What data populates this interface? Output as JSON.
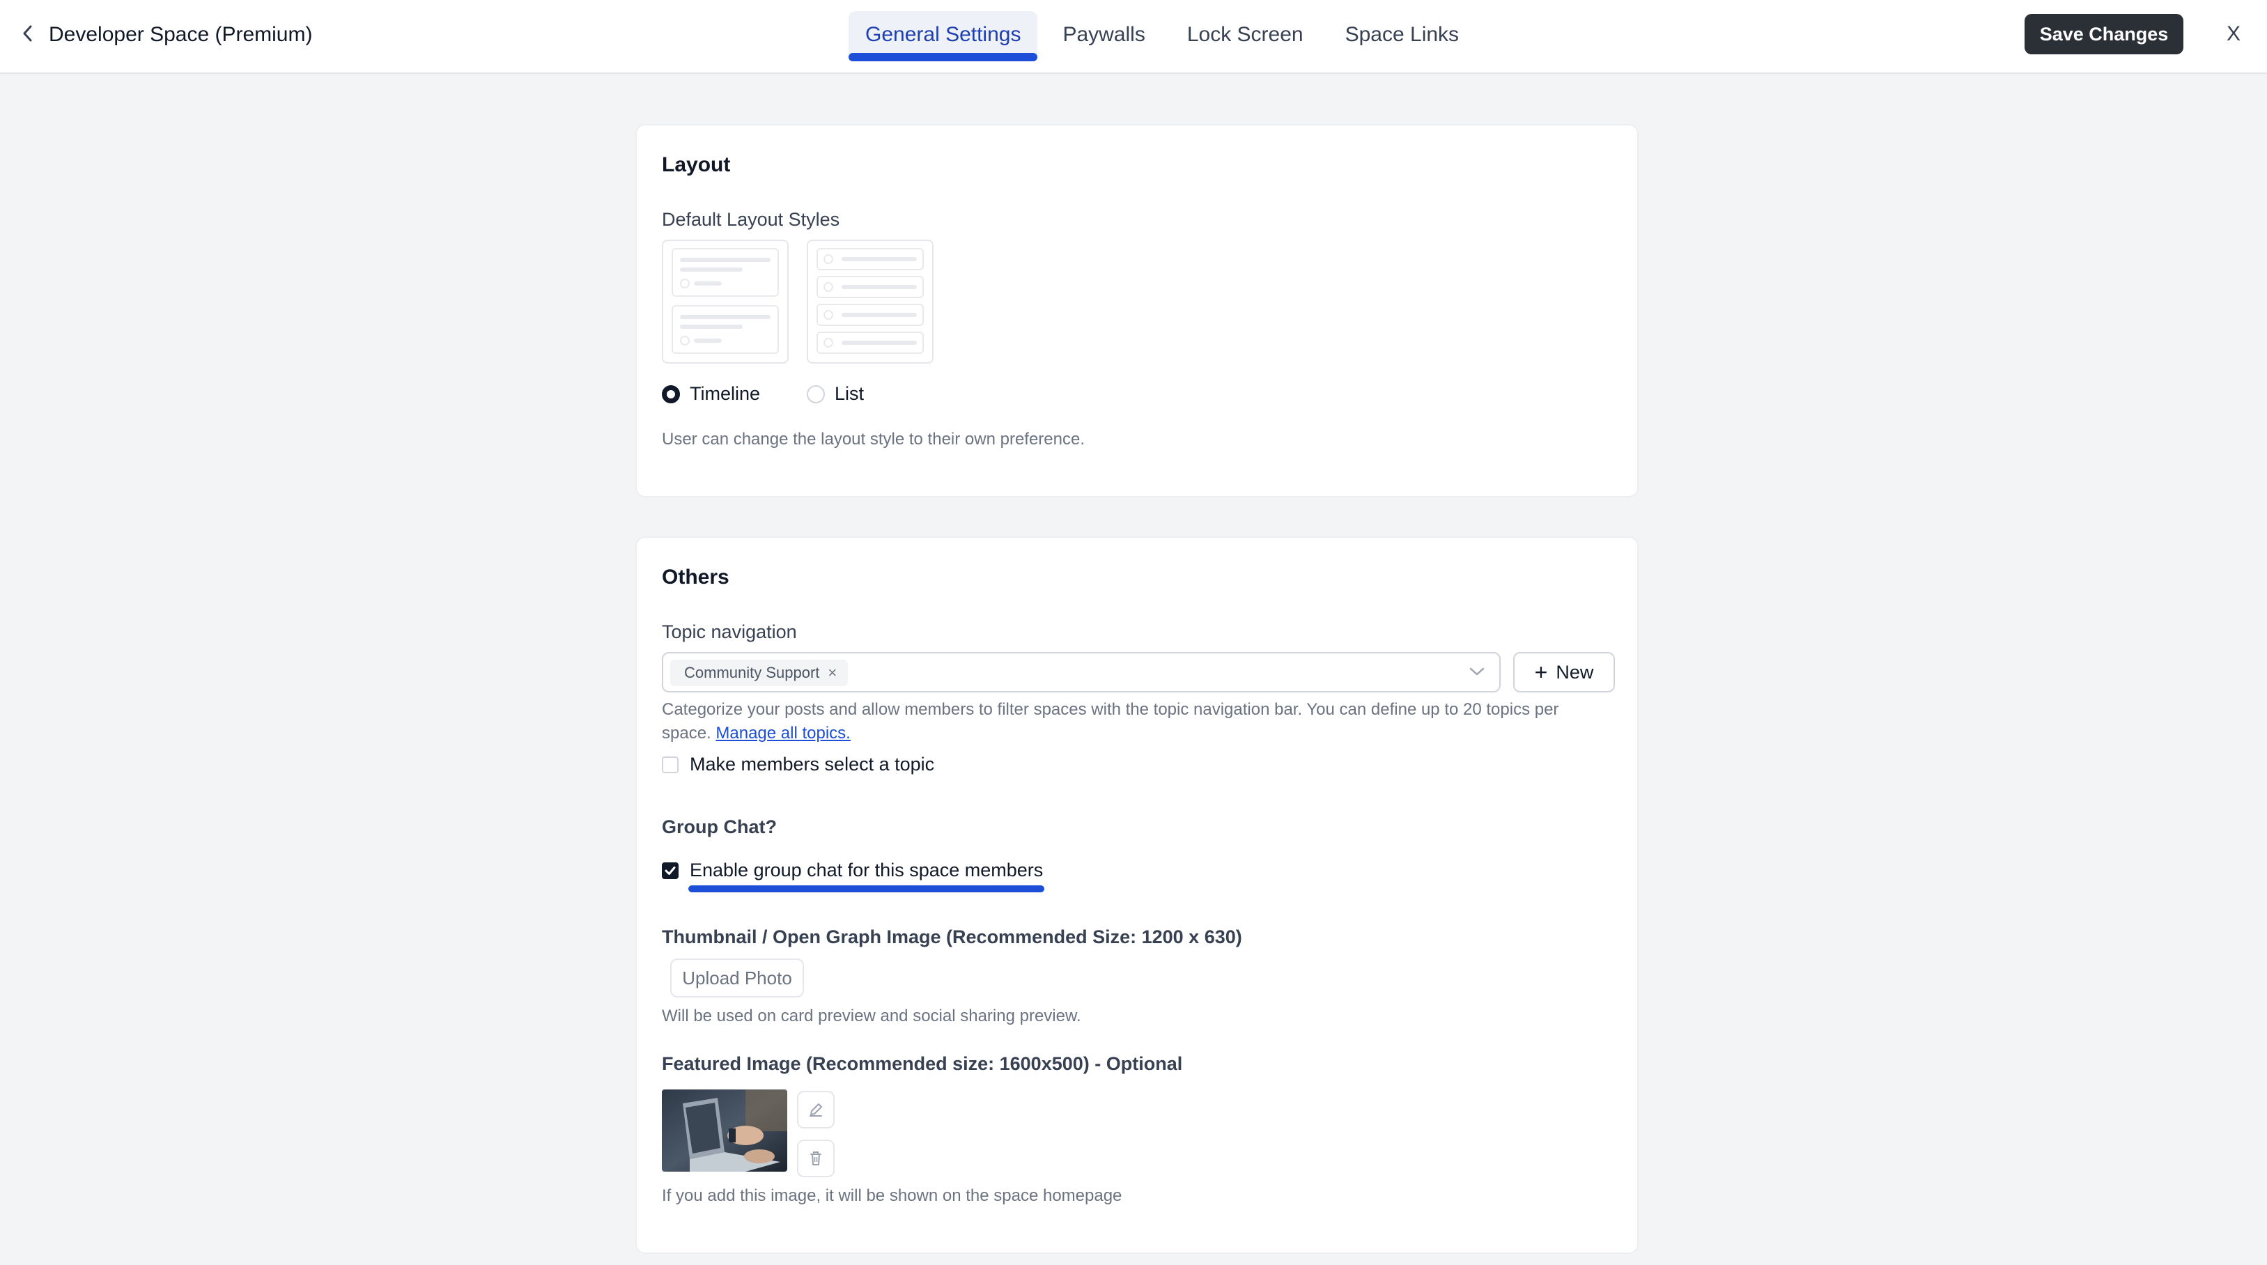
{
  "header": {
    "title": "Developer Space (Premium)",
    "tabs": [
      {
        "label": "General Settings",
        "active": true
      },
      {
        "label": "Paywalls",
        "active": false
      },
      {
        "label": "Lock Screen",
        "active": false
      },
      {
        "label": "Space Links",
        "active": false
      }
    ],
    "save_label": "Save Changes",
    "close_label": "X"
  },
  "layout_card": {
    "title": "Layout",
    "subtitle": "Default Layout Styles",
    "options": [
      {
        "label": "Timeline",
        "selected": true
      },
      {
        "label": "List",
        "selected": false
      }
    ],
    "help": "User can change the layout style to their own preference."
  },
  "others_card": {
    "title": "Others",
    "topic_navigation": {
      "label": "Topic navigation",
      "selected_chip": "Community Support",
      "chip_remove": "×",
      "new_label": "New",
      "help_line1": "Categorize your posts and allow members to filter spaces with the topic navigation bar. You can define up to 20 topics per",
      "help_line2": "space.",
      "manage_link": "Manage all topics.",
      "require_label": "Make members select a topic",
      "require_checked": false
    },
    "group_chat": {
      "label": "Group Chat?",
      "enable_label": "Enable group chat for this space members",
      "enabled": true
    },
    "thumbnail": {
      "label": "Thumbnail / Open Graph Image (Recommended Size: 1200 x 630)",
      "upload_label": "Upload Photo",
      "help": "Will be used on card preview and social sharing preview."
    },
    "featured": {
      "label": "Featured Image (Recommended size: 1600x500) - Optional",
      "help": "If you add this image, it will be shown on the space homepage"
    }
  },
  "colors": {
    "accent": "#1d4ed8",
    "primary_button": "#2b2f36",
    "background": "#f3f4f6"
  }
}
